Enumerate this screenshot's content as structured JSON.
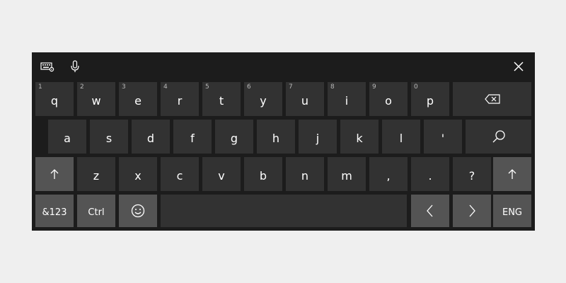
{
  "toolbar": {
    "keyboard_settings_icon": "keyboard-settings-icon",
    "microphone_icon": "microphone-icon",
    "close_icon": "close-icon"
  },
  "rows": {
    "row1": {
      "keys": [
        {
          "label": "q",
          "number": "1"
        },
        {
          "label": "w",
          "number": "2"
        },
        {
          "label": "e",
          "number": "3"
        },
        {
          "label": "r",
          "number": "4"
        },
        {
          "label": "t",
          "number": "5"
        },
        {
          "label": "y",
          "number": "6"
        },
        {
          "label": "u",
          "number": "7"
        },
        {
          "label": "i",
          "number": "8"
        },
        {
          "label": "o",
          "number": "9"
        },
        {
          "label": "p",
          "number": "0"
        }
      ],
      "backspace_icon": "backspace-icon"
    },
    "row2": {
      "keys": [
        "a",
        "s",
        "d",
        "f",
        "g",
        "h",
        "j",
        "k",
        "l",
        "'"
      ],
      "search_icon": "search-icon"
    },
    "row3": {
      "shift_icon": "shift-up-arrow-icon",
      "keys": [
        "z",
        "x",
        "c",
        "v",
        "b",
        "n",
        "m",
        ",",
        ".",
        "?"
      ]
    },
    "row4": {
      "symbols_label": "&123",
      "ctrl_label": "Ctrl",
      "emoji_icon": "emoji-icon",
      "left_icon": "chevron-left-icon",
      "right_icon": "chevron-right-icon",
      "language_label": "ENG"
    }
  },
  "colors": {
    "keyboard_bg": "#1c1c1c",
    "key_bg": "#323232",
    "key_light_bg": "#545454",
    "key_text": "#ffffff"
  }
}
